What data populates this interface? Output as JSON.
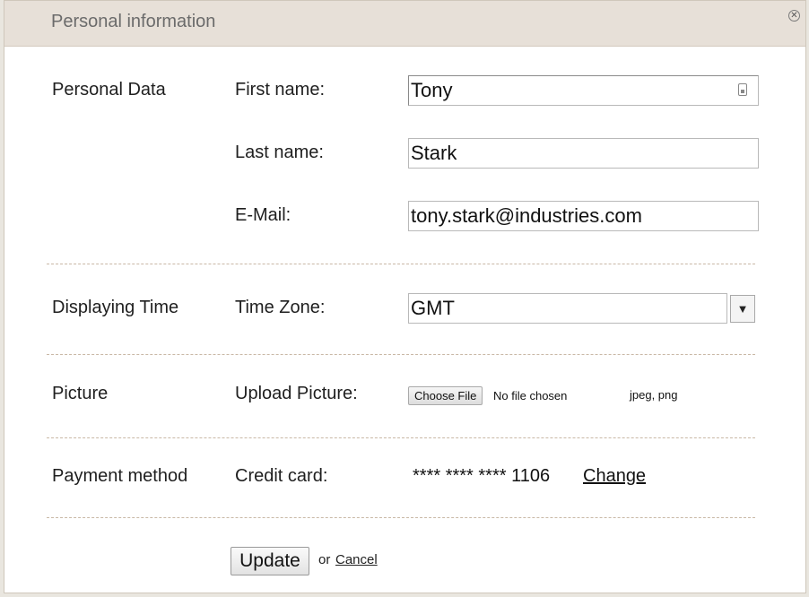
{
  "dialog": {
    "title": "Personal information",
    "close_icon": "close-circle-icon"
  },
  "personal_data": {
    "section_label": "Personal Data",
    "first_name": {
      "label": "First name:",
      "value": "Tony",
      "icon": "contact-card-icon"
    },
    "last_name": {
      "label": "Last name:",
      "value": "Stark"
    },
    "email": {
      "label": "E-Mail:",
      "value": "tony.stark@industries.com"
    }
  },
  "displaying_time": {
    "section_label": "Displaying Time",
    "time_zone": {
      "label": "Time Zone:",
      "selected": "GMT",
      "arrow": "▼"
    }
  },
  "picture": {
    "section_label": "Picture",
    "upload": {
      "label": "Upload Picture:",
      "button": "Choose File",
      "status": "No file chosen",
      "formats": "jpeg, png"
    }
  },
  "payment": {
    "section_label": "Payment method",
    "credit_card": {
      "label": "Credit card:",
      "number": "**** **** **** 1106",
      "change_link": "Change"
    }
  },
  "actions": {
    "update_label": "Update",
    "or_text": "or",
    "cancel_label": "Cancel"
  }
}
